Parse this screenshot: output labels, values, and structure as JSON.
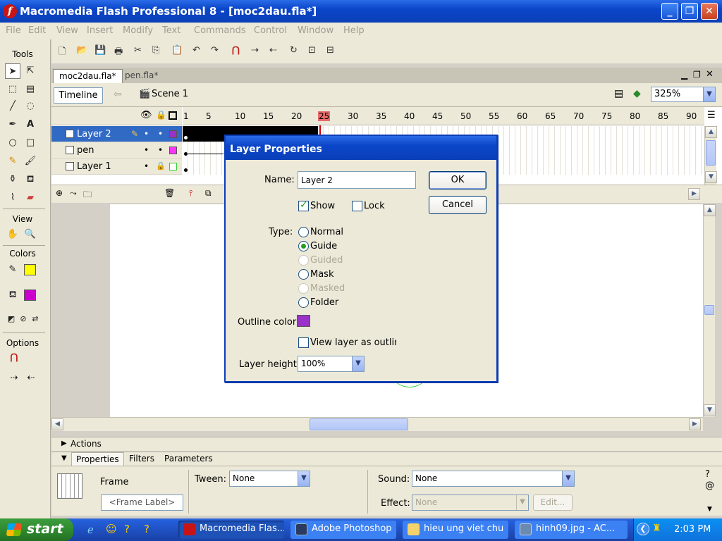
{
  "window": {
    "title": "Macromedia Flash Professional 8 - [moc2dau.fla*]"
  },
  "menu": [
    "File",
    "Edit",
    "View",
    "Insert",
    "Modify",
    "Text",
    "Commands",
    "Control",
    "Window",
    "Help"
  ],
  "tools": {
    "header": "Tools",
    "view_header": "View",
    "colors_header": "Colors",
    "options_header": "Options"
  },
  "doc_tabs": [
    {
      "label": "moc2dau.fla*"
    },
    {
      "label": "pen.fla*"
    }
  ],
  "edit_bar": {
    "timeline_label": "Timeline",
    "scene_label": "Scene 1",
    "zoom": "325%"
  },
  "timeline": {
    "layers": [
      {
        "name": "Layer 2"
      },
      {
        "name": "pen"
      },
      {
        "name": "Layer 1"
      }
    ],
    "frame_numbers": [
      "1",
      "5",
      "10",
      "15",
      "20",
      "25",
      "30",
      "35",
      "40",
      "45",
      "50",
      "55",
      "60",
      "65",
      "70",
      "75",
      "80",
      "85",
      "90"
    ]
  },
  "dialog": {
    "title": "Layer Properties",
    "name_label": "Name:",
    "name_value": "Layer 2",
    "ok_label": "OK",
    "cancel_label": "Cancel",
    "show_label": "Show",
    "lock_label": "Lock",
    "type_label": "Type:",
    "types": [
      "Normal",
      "Guide",
      "Guided",
      "Mask",
      "Masked",
      "Folder"
    ],
    "selected_type": "Guide",
    "outline_color_label": "Outline color:",
    "outline_color": "#9b31c8",
    "view_outline_label": "View layer as outlines",
    "height_label": "Layer height:",
    "height_value": "100%"
  },
  "panels": {
    "actions_label": "Actions",
    "tabs": [
      "Properties",
      "Filters",
      "Parameters"
    ],
    "frame_label": "Frame",
    "frame_label_placeholder": "<Frame Label>",
    "tween_label": "Tween:",
    "tween_value": "None",
    "sound_label": "Sound:",
    "sound_value": "None",
    "effect_label": "Effect:",
    "effect_value": "None",
    "edit_label": "Edit..."
  },
  "taskbar": {
    "start_label": "start",
    "tasks": [
      {
        "label": "Macromedia Flas..."
      },
      {
        "label": "Adobe Photoshop"
      },
      {
        "label": "hieu ung viet chu"
      },
      {
        "label": "hinh09.jpg - AC..."
      }
    ],
    "clock": "2:03 PM"
  },
  "colors": {
    "stroke": "#ffff00",
    "fill": "#cc00cc",
    "layer2": "#9b31c8",
    "pen": "#ff33ff",
    "layer1": "#33cc33",
    "title_blue": "#0b46c9"
  }
}
